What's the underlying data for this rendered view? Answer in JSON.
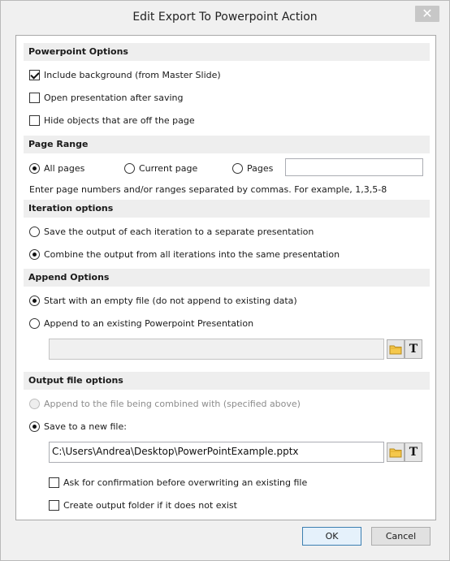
{
  "window": {
    "title": "Edit Export To Powerpoint Action",
    "close_glyph": "✕"
  },
  "powerpoint_options": {
    "header": "Powerpoint Options",
    "include_background": {
      "label": "Include background (from Master Slide)",
      "checked": true
    },
    "open_presentation": {
      "label": "Open presentation after saving",
      "checked": false
    },
    "hide_objects": {
      "label": "Hide objects that are off the page",
      "checked": false
    }
  },
  "page_range": {
    "header": "Page Range",
    "all_pages": "All pages",
    "current_page": "Current page",
    "pages": "Pages",
    "selected": "all_pages",
    "pages_value": "",
    "hint": "Enter page numbers and/or ranges separated by commas. For example, 1,3,5-8"
  },
  "iteration_options": {
    "header": "Iteration options",
    "separate": "Save the output of each iteration to a separate presentation",
    "combine": "Combine the output from all iterations into the same presentation",
    "selected": "combine"
  },
  "append_options": {
    "header": "Append Options",
    "empty_file": "Start with an empty file (do not append to existing data)",
    "existing": "Append to an existing Powerpoint Presentation",
    "selected": "empty_file",
    "existing_path": ""
  },
  "output_file_options": {
    "header": "Output file options",
    "append_combined": "Append to the file being combined with (specified above)",
    "save_new": "Save to a new file:",
    "selected": "save_new",
    "file_path": "C:\\Users\\Andrea\\Desktop\\PowerPointExample.pptx",
    "ask_confirmation": {
      "label": "Ask for confirmation before overwriting an existing file",
      "checked": false
    },
    "create_folder": {
      "label": "Create output folder if it does not exist",
      "checked": false
    }
  },
  "icons": {
    "folder": "folder-icon",
    "text": "text-icon",
    "text_glyph": "T"
  },
  "buttons": {
    "ok": "OK",
    "cancel": "Cancel"
  },
  "colors": {
    "folder_fill": "#f5c84c",
    "folder_stroke": "#b78a1c",
    "ok_border": "#3c7fb1"
  }
}
